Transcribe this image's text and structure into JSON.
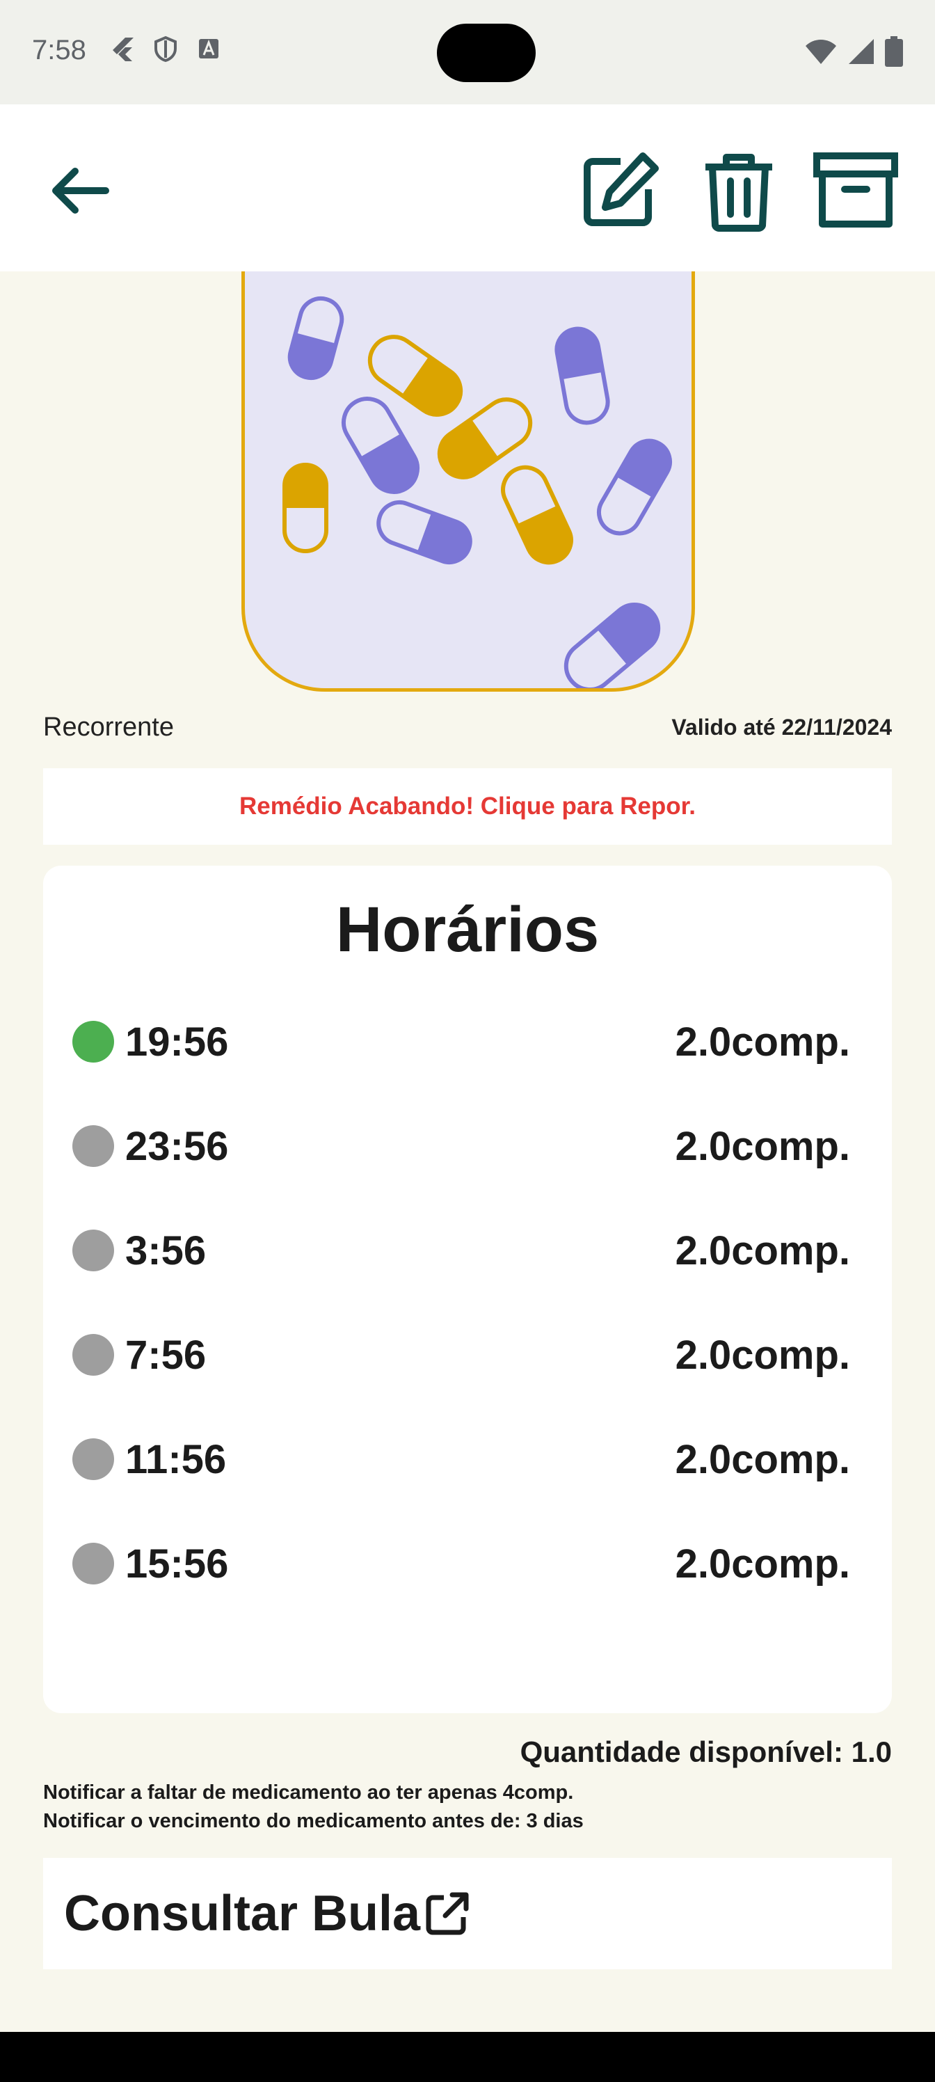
{
  "status_bar": {
    "time": "7:58"
  },
  "app_bar": {
    "back_icon": "arrow-left-icon",
    "actions": [
      "edit-icon",
      "trash-icon",
      "archive-icon"
    ]
  },
  "medication": {
    "recurrence": "Recorrente",
    "valid_until": "Valido até 22/11/2024",
    "alert": "Remédio Acabando! Clique para Repor."
  },
  "schedule": {
    "title": "Horários",
    "slots": [
      {
        "time": "19:56",
        "dose": "2.0comp.",
        "status_color": "#4caf50"
      },
      {
        "time": "23:56",
        "dose": "2.0comp.",
        "status_color": "#9e9e9e"
      },
      {
        "time": "3:56",
        "dose": "2.0comp.",
        "status_color": "#9e9e9e"
      },
      {
        "time": "7:56",
        "dose": "2.0comp.",
        "status_color": "#9e9e9e"
      },
      {
        "time": "11:56",
        "dose": "2.0comp.",
        "status_color": "#9e9e9e"
      },
      {
        "time": "15:56",
        "dose": "2.0comp.",
        "status_color": "#9e9e9e"
      }
    ]
  },
  "quantity": "Quantidade disponível: 1.0",
  "notifications": {
    "low_stock": "Notificar a faltar de medicamento ao ter apenas 4comp.",
    "expiry": "Notificar o vencimento do medicamento antes de: 3 dias"
  },
  "leaflet": {
    "label": "Consultar Bula",
    "icon": "external-link-icon"
  },
  "colors": {
    "accent": "#0f4a4a",
    "pill_purple": "#7b76d6",
    "pill_gold": "#dba400",
    "alert_red": "#e53935",
    "background": "#f8f7ed"
  }
}
